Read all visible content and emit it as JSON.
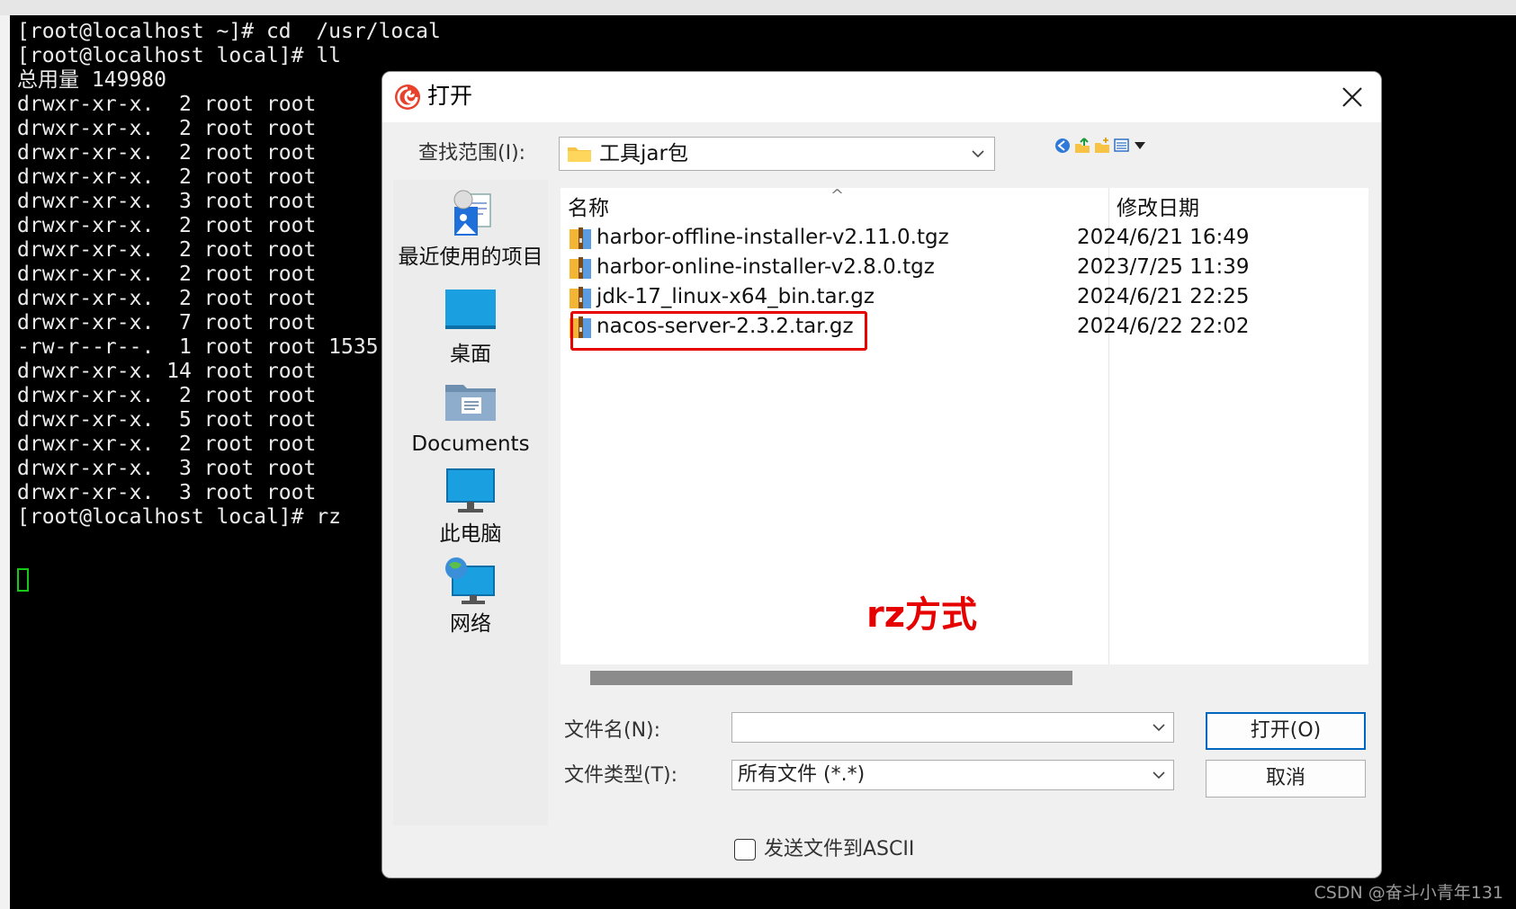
{
  "terminal": {
    "lines": [
      "[root@localhost ~]# cd  /usr/local",
      "[root@localhost local]# ll",
      "总用量 149980",
      "drwxr-xr-x.  2 root root",
      "drwxr-xr-x.  2 root root",
      "drwxr-xr-x.  2 root root",
      "drwxr-xr-x.  2 root root",
      "drwxr-xr-x.  3 root root",
      "drwxr-xr-x.  2 root root",
      "drwxr-xr-x.  2 root root",
      "drwxr-xr-x.  2 root root",
      "drwxr-xr-x.  2 root root",
      "drwxr-xr-x.  7 root root",
      "-rw-r--r--.  1 root root 1535",
      "drwxr-xr-x. 14 root root",
      "drwxr-xr-x.  2 root root",
      "drwxr-xr-x.  5 root root",
      "drwxr-xr-x.  2 root root",
      "drwxr-xr-x.  3 root root",
      "drwxr-xr-x.  3 root root",
      "[root@localhost local]# rz"
    ]
  },
  "dialog": {
    "title": "打开",
    "look_in_label": "查找范围(I):",
    "look_in_value": "工具jar包",
    "places": [
      {
        "label": "最近使用的项目",
        "icon": "recent-items-icon"
      },
      {
        "label": "桌面",
        "icon": "desktop-icon"
      },
      {
        "label": "Documents",
        "icon": "documents-icon"
      },
      {
        "label": "此电脑",
        "icon": "this-pc-icon"
      },
      {
        "label": "网络",
        "icon": "network-icon"
      }
    ],
    "columns": {
      "name": "名称",
      "date": "修改日期"
    },
    "files": [
      {
        "name": "harbor-offline-installer-v2.11.0.tgz",
        "date": "2024/6/21 16:49"
      },
      {
        "name": "harbor-online-installer-v2.8.0.tgz",
        "date": "2023/7/25 11:39"
      },
      {
        "name": "jdk-17_linux-x64_bin.tar.gz",
        "date": "2024/6/21 22:25"
      },
      {
        "name": "nacos-server-2.3.2.tar.gz",
        "date": "2024/6/22 22:02"
      }
    ],
    "annotation": "rz方式",
    "filename_label": "文件名(N):",
    "filename_value": "",
    "filetype_label": "文件类型(T):",
    "filetype_value": "所有文件 (*.*)",
    "open_button": "打开(O)",
    "cancel_button": "取消",
    "ascii_checkbox_label": "发送文件到ASCII",
    "ascii_checked": false
  },
  "watermark": "CSDN @奋斗小青年131",
  "colors": {
    "highlight": "#e60000",
    "accent": "#0067c0",
    "terminal_bg": "#000000",
    "cursor": "#18c818"
  }
}
